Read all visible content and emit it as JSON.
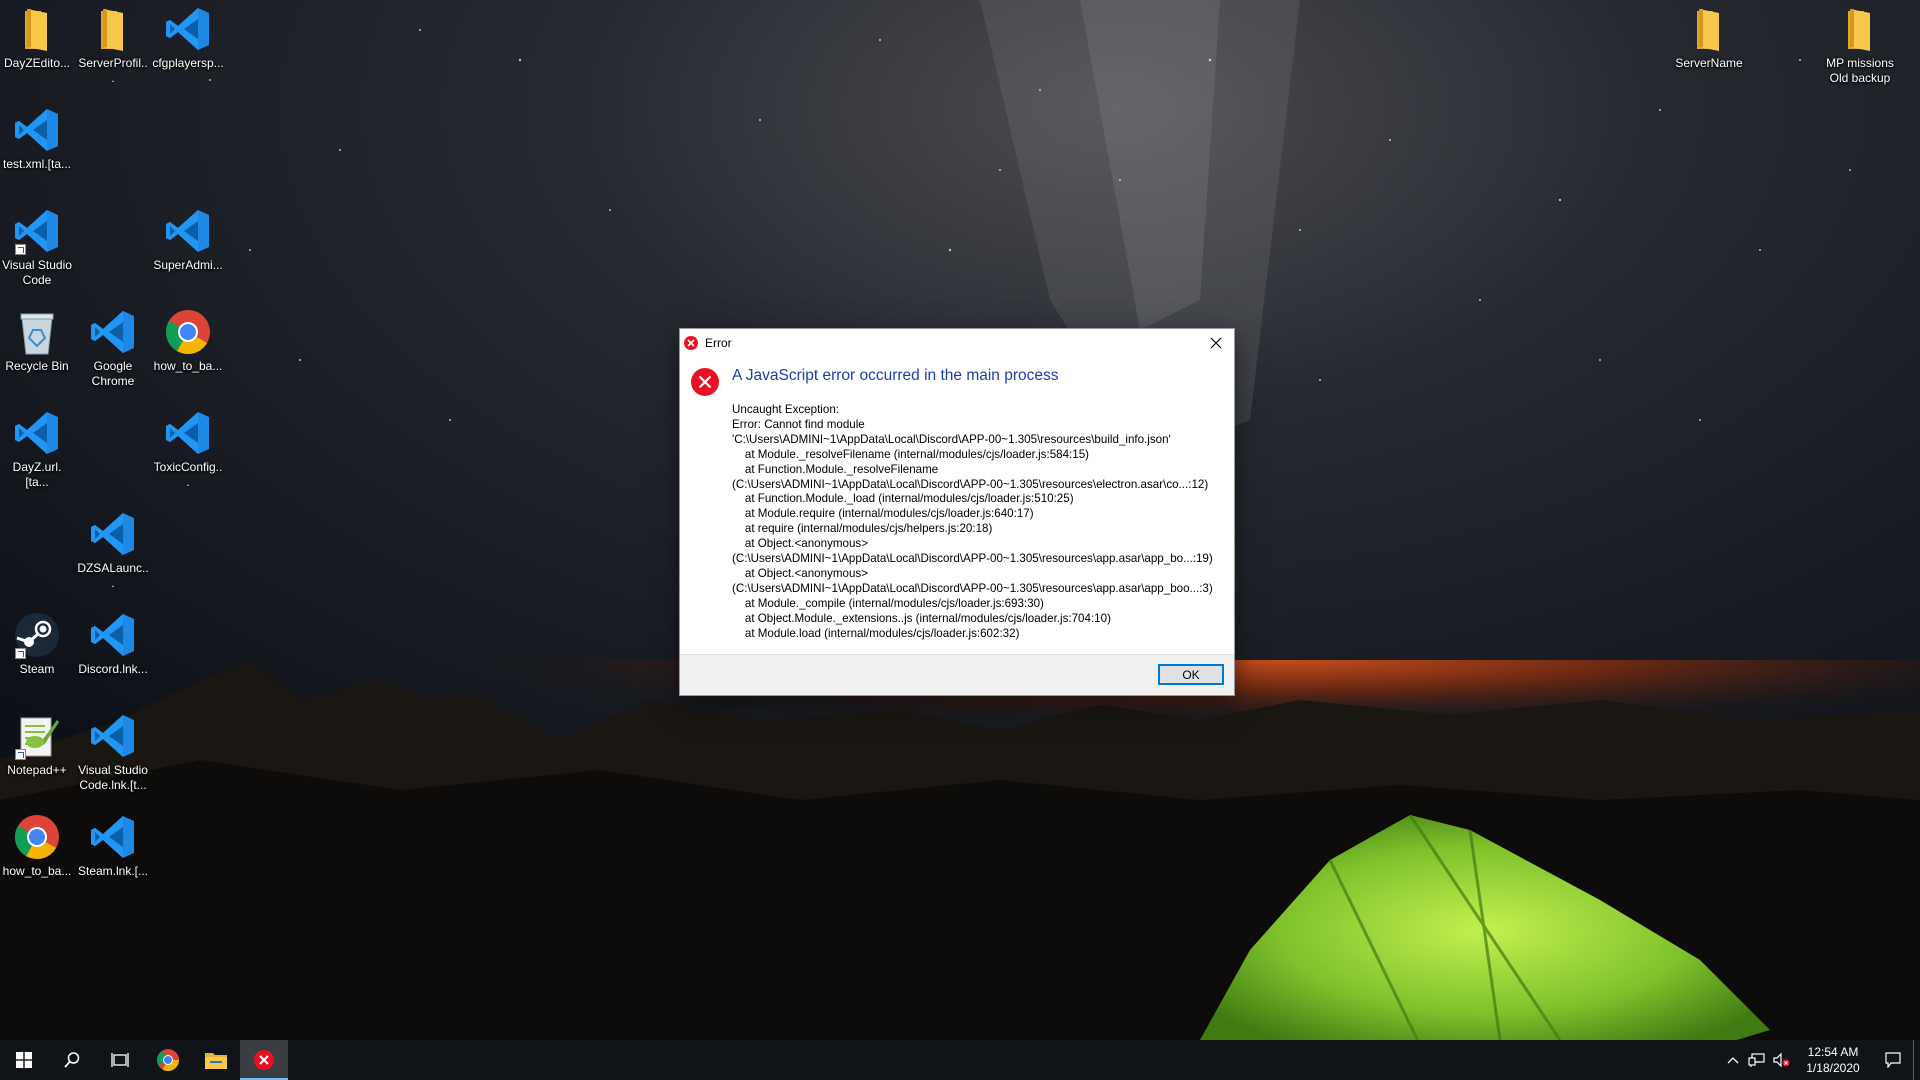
{
  "desktop": {
    "icons": [
      {
        "label": "DayZEdito...",
        "icon": "folder-icon"
      },
      {
        "label": "ServerProfil...",
        "icon": "folder-icon"
      },
      {
        "label": "cfgplayersp...",
        "icon": "vscode-icon"
      },
      {
        "label": "test.xml.[ta...",
        "icon": "vscode-icon"
      },
      {
        "label": "Visual Studio Code",
        "icon": "vscode-icon"
      },
      {
        "label": "SuperAdmi...",
        "icon": "vscode-icon"
      },
      {
        "label": "Recycle Bin",
        "icon": "recycle-bin-icon"
      },
      {
        "label": "Google Chrome",
        "icon": "vscode-icon"
      },
      {
        "label": "how_to_ba...",
        "icon": "chrome-icon"
      },
      {
        "label": "DayZ.url.[ta...",
        "icon": "vscode-icon"
      },
      {
        "label": "ToxicConfig...",
        "icon": "vscode-icon"
      },
      {
        "label": "DZSALaunc...",
        "icon": "vscode-icon"
      },
      {
        "label": "Steam",
        "icon": "steam-icon"
      },
      {
        "label": "Discord.lnk...",
        "icon": "vscode-icon"
      },
      {
        "label": "Notepad++",
        "icon": "notepadpp-icon"
      },
      {
        "label": "Visual Studio Code.lnk.[t...",
        "icon": "vscode-icon"
      },
      {
        "label": "how_to_ba...",
        "icon": "chrome-icon"
      },
      {
        "label": "Steam.lnk.[...",
        "icon": "vscode-icon"
      },
      {
        "label": "ServerName",
        "icon": "folder-icon"
      },
      {
        "label": "MP missions Old backup",
        "icon": "folder-icon"
      }
    ]
  },
  "dialog": {
    "title": "Error",
    "main_instruction": "A JavaScript error occurred in the main process",
    "content_lines": [
      "Uncaught Exception:",
      "Error: Cannot find module",
      "'C:\\Users\\ADMINI~1\\AppData\\Local\\Discord\\APP-00~1.305\\resources\\build_info.json'",
      "    at Module._resolveFilename (internal/modules/cjs/loader.js:584:15)",
      "    at Function.Module._resolveFilename",
      "(C:\\Users\\ADMINI~1\\AppData\\Local\\Discord\\APP-00~1.305\\resources\\electron.asar\\co...:12)",
      "    at Function.Module._load (internal/modules/cjs/loader.js:510:25)",
      "    at Module.require (internal/modules/cjs/loader.js:640:17)",
      "    at require (internal/modules/cjs/helpers.js:20:18)",
      "    at Object.<anonymous>",
      "(C:\\Users\\ADMINI~1\\AppData\\Local\\Discord\\APP-00~1.305\\resources\\app.asar\\app_bo...:19)",
      "    at Object.<anonymous>",
      "(C:\\Users\\ADMINI~1\\AppData\\Local\\Discord\\APP-00~1.305\\resources\\app.asar\\app_boo...:3)",
      "    at Module._compile (internal/modules/cjs/loader.js:693:30)",
      "    at Object.Module._extensions..js (internal/modules/cjs/loader.js:704:10)",
      "    at Module.load (internal/modules/cjs/loader.js:602:32)"
    ],
    "ok_label": "OK"
  },
  "taskbar": {
    "items": [
      "start-icon",
      "search-icon",
      "task-view-icon",
      "chrome-icon",
      "file-explorer-icon",
      "error-app-icon"
    ],
    "clock": {
      "time": "12:54 AM",
      "date": "1/18/2020"
    },
    "accent": "#76b9ed"
  },
  "colors": {
    "instruction_blue": "#1c3fa8",
    "error_red": "#e81123",
    "tent_green": "#8fd13c"
  }
}
